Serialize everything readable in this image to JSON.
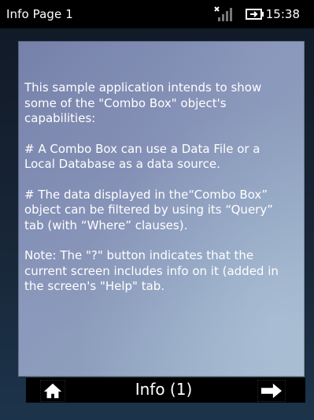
{
  "status_bar": {
    "title": "Info Page 1",
    "time": "15:38",
    "icons": [
      "signal-off-icon",
      "battery-charging-icon"
    ]
  },
  "info": {
    "paragraphs": [
      "This sample application intends to show some of the \"Combo Box\" object's capabilities:",
      "# A Combo Box can use a Data File or a Local Database as a data source.",
      "# The data displayed in the“Combo Box” object can be filtered by using its “Query” tab (with “Where” clauses).",
      "Note: The \"?\" button indicates that the current screen includes info on it (added in the screen's \"Help\" tab."
    ]
  },
  "nav": {
    "title": "Info (1)",
    "icons": [
      "home-icon",
      "arrow-right-icon"
    ]
  },
  "colors": {
    "status_bar_bg": "#000000",
    "panel_tint": "#8a97bb",
    "text": "#ffffff"
  }
}
